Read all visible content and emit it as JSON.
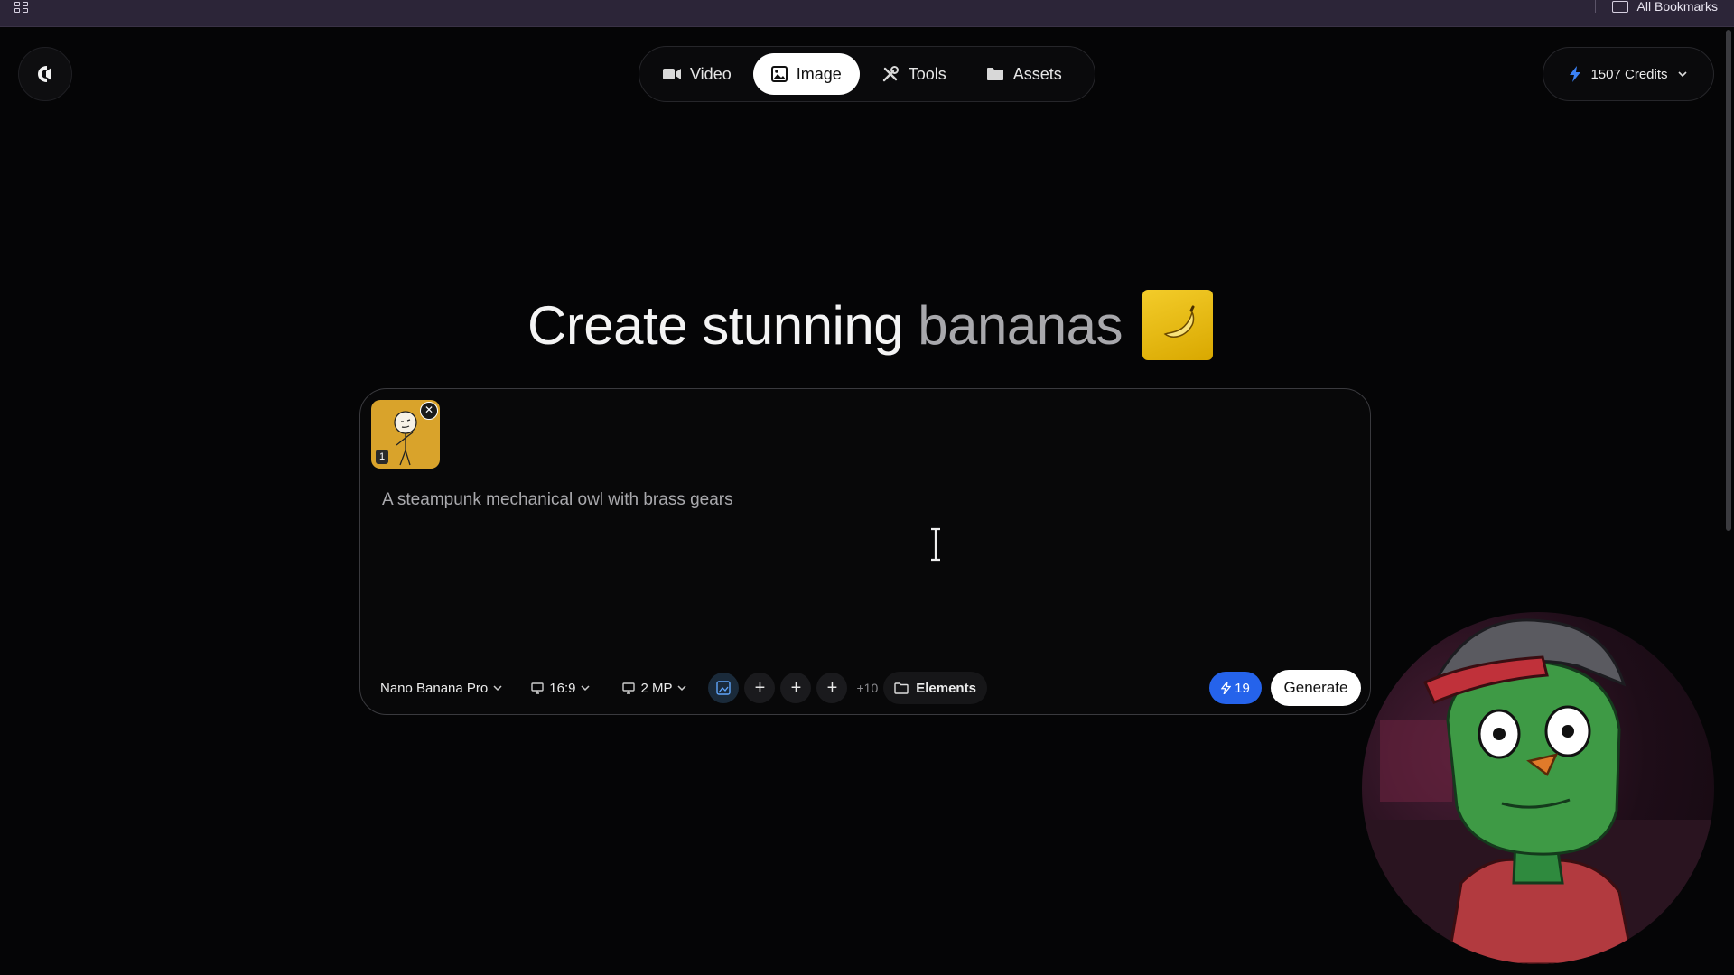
{
  "browser": {
    "bookmarks_label": "All Bookmarks"
  },
  "nav": {
    "tabs": [
      {
        "label": "Video",
        "icon": "video-camera-icon"
      },
      {
        "label": "Image",
        "icon": "image-icon",
        "active": true
      },
      {
        "label": "Tools",
        "icon": "tools-icon"
      },
      {
        "label": "Assets",
        "icon": "folder-icon"
      }
    ]
  },
  "credits": {
    "label": "1507 Credits",
    "icon": "lightning-icon"
  },
  "hero": {
    "title_main": "Create stunning",
    "title_accent": "bananas",
    "emoji": "🍌"
  },
  "prompt": {
    "placeholder": "A steampunk mechanical owl with brass gears",
    "attachment": {
      "index": "1",
      "remove_icon": "close-icon"
    }
  },
  "toolbar": {
    "model": "Nano Banana Pro",
    "aspect_ratio": "16:9",
    "resolution": "2 MP",
    "extra_refs": "+10",
    "elements_label": "Elements",
    "cost": "19",
    "generate_label": "Generate"
  },
  "colors": {
    "background": "#050506",
    "accent_blue": "#2563eb",
    "banana_yellow": "#f3cc2a"
  }
}
